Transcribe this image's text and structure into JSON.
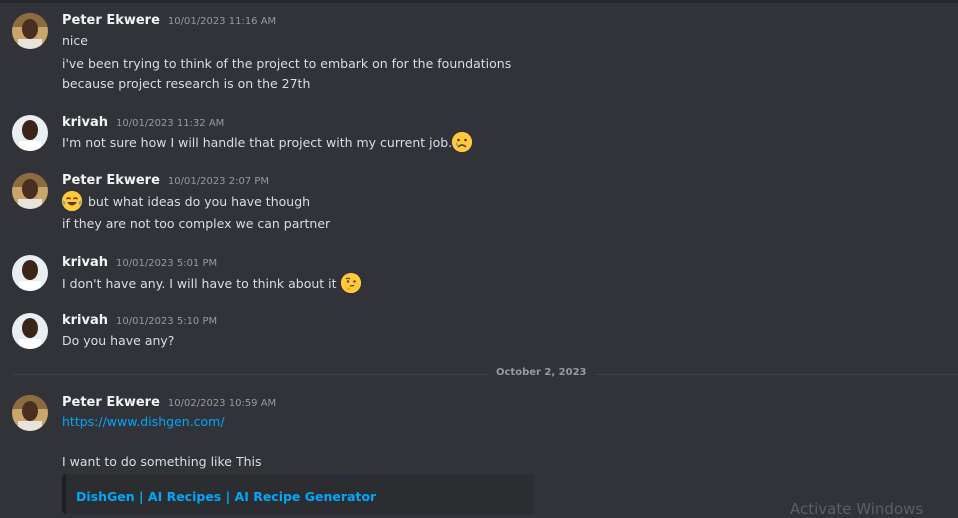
{
  "messages": [
    {
      "author": "Peter Ekwere",
      "timestamp": "10/01/2023 11:16 AM",
      "lines": [
        "nice",
        "i've been trying to think of the project to embark on for the foundations",
        "because project research is on the 27th"
      ]
    },
    {
      "author": "krivah",
      "timestamp": "10/01/2023 11:32 AM",
      "lines": [
        "I'm not sure how I will handle that project with my current job."
      ],
      "emoji": "crying-face-emoji"
    },
    {
      "author": "Peter Ekwere",
      "timestamp": "10/01/2023 2:07 PM",
      "lines": [
        "but what ideas do you have though",
        "if they are not too complex we can partner"
      ],
      "emoji": "tears-of-joy-emoji"
    },
    {
      "author": "krivah",
      "timestamp": "10/01/2023 5:01 PM",
      "lines": [
        "I don't have any. I will have to think about it"
      ],
      "emoji": "thinking-face-emoji"
    },
    {
      "author": "krivah",
      "timestamp": "10/01/2023 5:10 PM",
      "lines": [
        "Do you have any?"
      ]
    },
    {
      "author": "Peter Ekwere",
      "timestamp": "10/02/2023 10:59 AM",
      "link": "https://www.dishgen.com/",
      "lines": [
        "I want to do something like This"
      ],
      "embed_title": "DishGen | AI Recipes | AI Recipe Generator"
    }
  ],
  "date_divider": "October 2, 2023",
  "watermark": "Activate Windows",
  "colors": {
    "background": "#313338",
    "link": "#00a8fc",
    "username": "#f2f3f5",
    "timestamp": "#949ba4",
    "embed_background": "#2b2d31"
  }
}
